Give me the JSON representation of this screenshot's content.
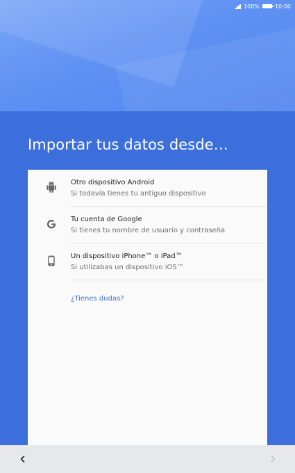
{
  "status_bar": {
    "battery": "100%",
    "time": "10:00",
    "icons": [
      "signal-icon",
      "battery-icon"
    ]
  },
  "page": {
    "title": "Importar tus datos desde…"
  },
  "options": [
    {
      "icon": "android-icon",
      "title": "Otro dispositivo Android",
      "subtitle": "Si todavía tienes tu antiguo dispositivo"
    },
    {
      "icon": "google-icon",
      "title": "Tu cuenta de Google",
      "subtitle": "Si tienes tu nombre de usuario y contraseña"
    },
    {
      "icon": "phone-icon",
      "title": "Un dispositivo iPhone™ o iPad™",
      "subtitle": "Si utilizabas un dispositivo iOS™"
    }
  ],
  "help": {
    "label": "¿Tienes dudas?"
  },
  "nav": {
    "back_icon": "chevron-left-icon",
    "next_icon": "chevron-right-icon"
  },
  "colors": {
    "accent": "#3d6fdc",
    "hero": "#6a9bf5",
    "card": "#fafafa",
    "nav": "#e7e8ec"
  }
}
